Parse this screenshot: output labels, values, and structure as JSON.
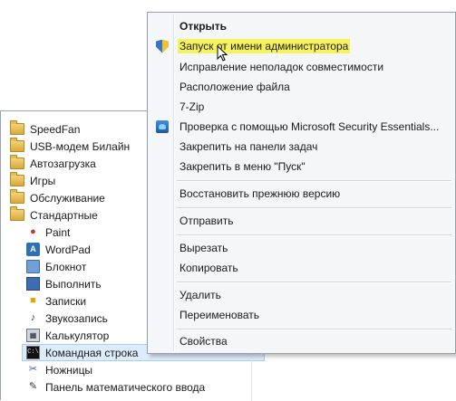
{
  "programs": {
    "folders": [
      {
        "label": "SpeedFan"
      },
      {
        "label": "USB-модем Билайн"
      },
      {
        "label": "Автозагрузка"
      },
      {
        "label": "Игры"
      },
      {
        "label": "Обслуживание"
      },
      {
        "label": "Стандартные"
      }
    ],
    "apps": [
      {
        "label": "Paint",
        "icon": "paint-icon"
      },
      {
        "label": "WordPad",
        "icon": "wordpad-icon"
      },
      {
        "label": "Блокнот",
        "icon": "notepad-icon"
      },
      {
        "label": "Выполнить",
        "icon": "run-icon"
      },
      {
        "label": "Записки",
        "icon": "sticky-notes-icon"
      },
      {
        "label": "Звукозапись",
        "icon": "microphone-icon"
      },
      {
        "label": "Калькулятор",
        "icon": "calculator-icon"
      },
      {
        "label": "Командная строка",
        "icon": "command-prompt-icon",
        "highlighted": true
      },
      {
        "label": "Ножницы",
        "icon": "scissors-icon"
      },
      {
        "label": "Панель математического ввода",
        "icon": "pen-icon"
      }
    ]
  },
  "context_menu": {
    "items": {
      "open": "Открыть",
      "run_as_admin": "Запуск от имени администратора",
      "troubleshoot": "Исправление неполадок совместимости",
      "file_location": "Расположение файла",
      "seven_zip": "7-Zip",
      "mse_scan": "Проверка с помощью Microsoft Security Essentials...",
      "pin_taskbar": "Закрепить на панели задач",
      "pin_start": "Закрепить в меню \"Пуск\"",
      "restore": "Восстановить прежнюю версию",
      "send_to": "Отправить",
      "cut": "Вырезать",
      "copy": "Копировать",
      "delete": "Удалить",
      "rename": "Переименовать",
      "properties": "Свойства"
    },
    "highlight_color": "#f6f35a"
  }
}
